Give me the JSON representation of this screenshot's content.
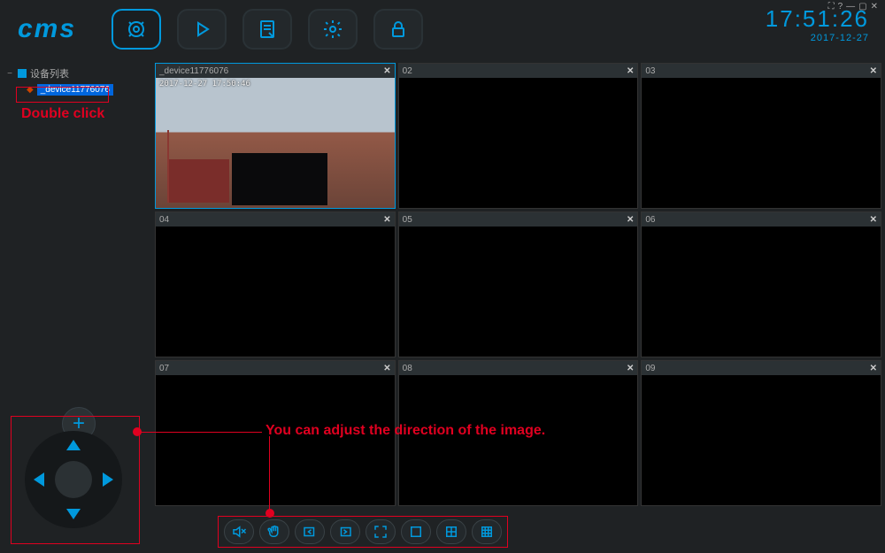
{
  "app": {
    "logo": "cms"
  },
  "clock": {
    "time": "17:51:26",
    "date": "2017-12-27"
  },
  "system_icons": [
    "⛶",
    "?",
    "—",
    "▢",
    "✕"
  ],
  "tree": {
    "root_label": "设备列表",
    "child_label": "_device11776076"
  },
  "annotations": {
    "double_click": "Double click",
    "adjust_direction": "You can adjust the direction of the image."
  },
  "tiles": [
    {
      "id": "01",
      "label": "_device11776076",
      "osd": "2017-12-27  17:50:46",
      "active": true,
      "has_video": true
    },
    {
      "id": "02",
      "label": "02",
      "active": false,
      "has_video": false
    },
    {
      "id": "03",
      "label": "03",
      "active": false,
      "has_video": false
    },
    {
      "id": "04",
      "label": "04",
      "active": false,
      "has_video": false
    },
    {
      "id": "05",
      "label": "05",
      "active": false,
      "has_video": false
    },
    {
      "id": "06",
      "label": "06",
      "active": false,
      "has_video": false
    },
    {
      "id": "07",
      "label": "07",
      "active": false,
      "has_video": false
    },
    {
      "id": "08",
      "label": "08",
      "active": false,
      "has_video": false
    },
    {
      "id": "09",
      "label": "09",
      "active": false,
      "has_video": false
    }
  ]
}
